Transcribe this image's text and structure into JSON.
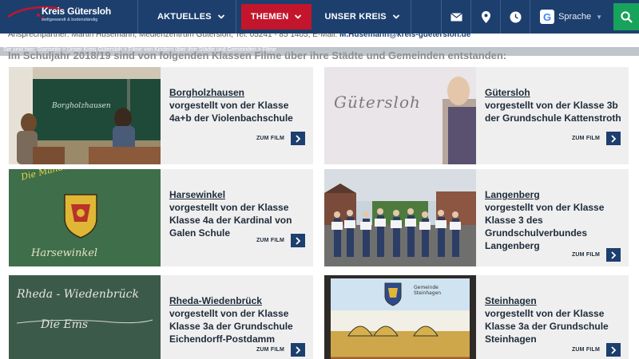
{
  "header": {
    "logo_title": "Kreis Gütersloh",
    "logo_subtitle": "weltgewandt & bodenständig",
    "nav": [
      {
        "label": "AKTUELLES"
      },
      {
        "label": "THEMEN"
      },
      {
        "label": "UNSER KREIS"
      }
    ],
    "language_label": "Sprache",
    "icons": [
      "envelope-icon",
      "location-pin-icon",
      "clock-icon",
      "google-icon",
      "search-icon"
    ],
    "colors": {
      "navy": "#1d3f6e",
      "active_red": "#c3162c",
      "search_green": "#17a35b"
    }
  },
  "contact": {
    "text": "Ansprechpartner: Martin Husemann, Medienzentrum Gütersloh, Tel: 05241 - 85 1405, E-Mail: ",
    "email": "M.Husemann@kreis-guetersloh.de"
  },
  "breadcrumb": "Sie sind hier: Startseite > Unser Kreis Gütersloh > Filme von Kindern über ihre Städte und Gemeinden > Filme",
  "section_heading": "Im Schuljahr 2018/19 sind von folgenden Klassen Filme über ihre Städte und Gemeinden entstanden:",
  "film_link_label": "ZUM FILM",
  "cards": [
    {
      "place": "Borgholzhausen",
      "description": "vorgestellt von der Klasse 4a+b der Violenbachschule",
      "thumb_text": "Borgholzhausen"
    },
    {
      "place": "Gütersloh",
      "description": "vorgestellt von der Klasse 3b der Grundschule Kattenstroth",
      "thumb_text": "Gütersloh"
    },
    {
      "place": "Harsewinkel",
      "description": "vorgestellt von der Klasse Klasse 4a der Kardinal von Galen Schule",
      "thumb_text": "Die Mähdrescherstadt",
      "thumb_text2": "Harsewinkel"
    },
    {
      "place": "Langenberg",
      "description": "vorgestellt von der Klasse Klasse 3 des Grundschulverbundes Langenberg",
      "thumb_text": ""
    },
    {
      "place": "Rheda-Wiedenbrück",
      "description": "vorgestellt von der Klasse Klasse 3a der Grundschule Eichendorff-Postdamm",
      "thumb_text": "Rheda - Wiedenbrück",
      "thumb_text2": "Die Ems"
    },
    {
      "place": "Steinhagen",
      "description": "vorgestellt von der Klasse Klasse 3a der Grundschule Steinhagen",
      "thumb_text": "Gemeinde Steinhagen"
    }
  ]
}
